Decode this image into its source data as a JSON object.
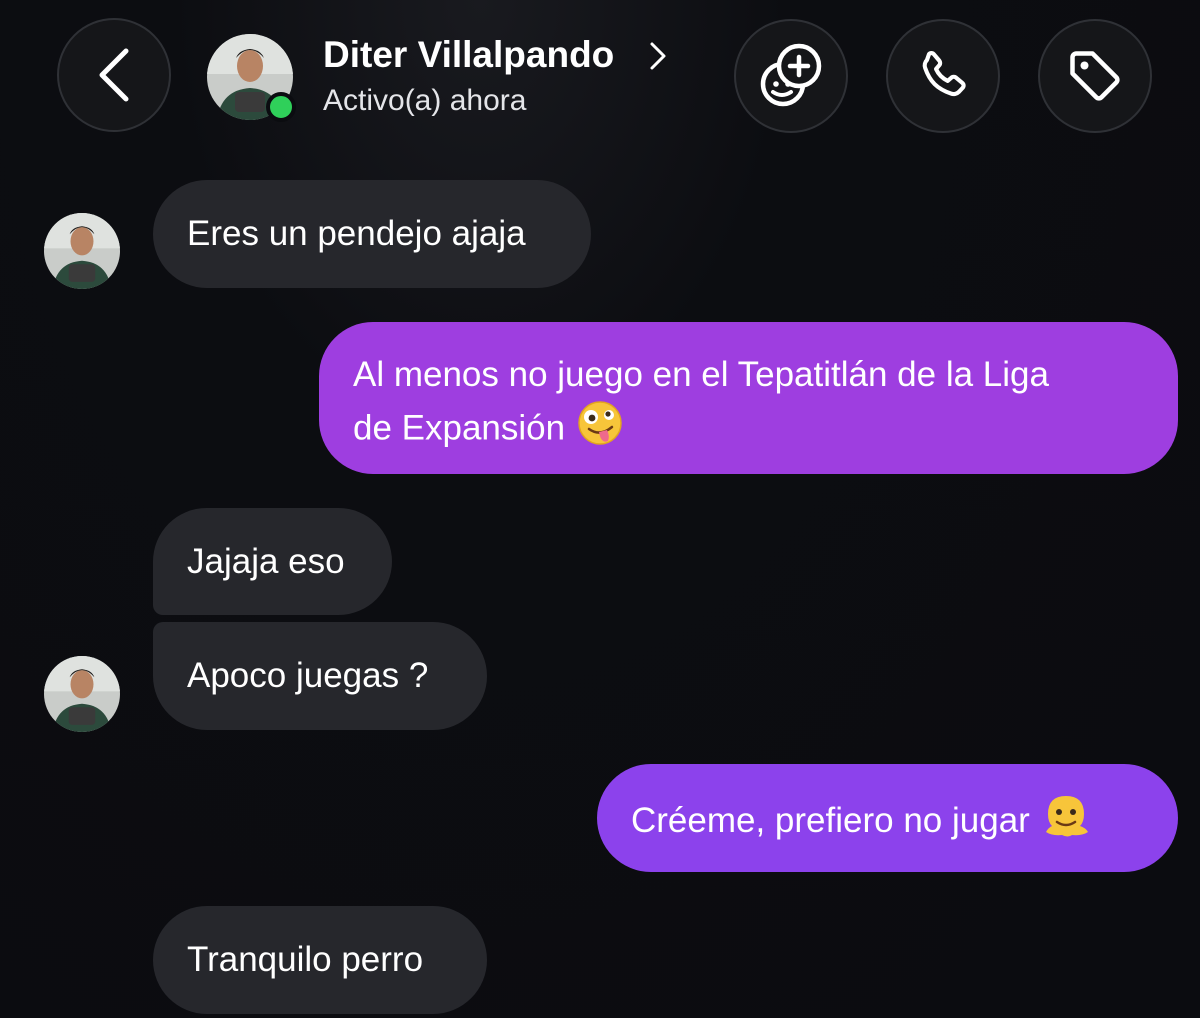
{
  "header": {
    "contact_name": "Diter Villalpando",
    "status": "Activo(a) ahora",
    "icons": {
      "back": "chevron-left-icon",
      "game": "game-add-icon",
      "call": "phone-icon",
      "tag": "tag-icon"
    }
  },
  "messages": [
    {
      "side": "received",
      "text": "Eres un pendejo ajaja"
    },
    {
      "side": "sent",
      "line1": "Al menos no juego en el Tepatitlán de la Liga",
      "line2": "de Expansión",
      "emoji": "zany-face-emoji"
    },
    {
      "side": "received",
      "text": "Jajaja eso"
    },
    {
      "side": "received",
      "text": "Apoco juegas ?"
    },
    {
      "side": "sent",
      "text": "Créeme, prefiero no jugar",
      "emoji": "melting-face-emoji"
    },
    {
      "side": "received",
      "text": "Tranquilo perro"
    }
  ],
  "colors": {
    "background": "#0b0c10",
    "received_bubble": "#26272c",
    "sent_bubble": "#9e3ee0",
    "online": "#2fd05a"
  }
}
